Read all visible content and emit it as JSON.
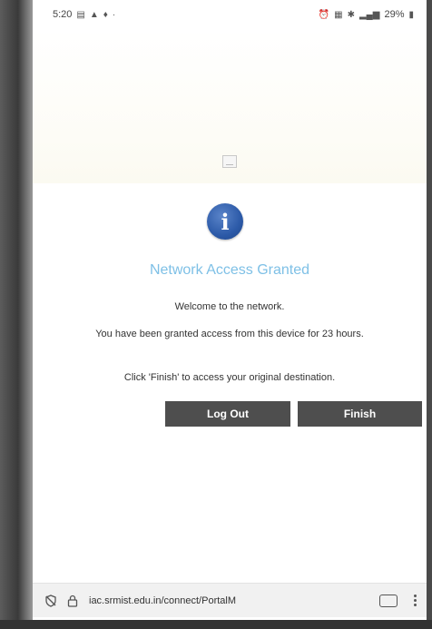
{
  "status_bar": {
    "time": "5:20",
    "right_text": "29%"
  },
  "main": {
    "title": "Network Access Granted",
    "welcome": "Welcome to the network.",
    "access_message": "You have been granted access from this device for 23 hours.",
    "finish_instruction": "Click 'Finish' to access your original destination.",
    "logout_label": "Log Out",
    "finish_label": "Finish"
  },
  "address_bar": {
    "url": "iac.srmist.edu.in/connect/PortalM"
  },
  "colors": {
    "title": "#7ec0e6",
    "button_bg": "#4e4e4e",
    "info_icon": "#2c5aa8"
  },
  "icons": [
    "shield-off-icon",
    "lock-icon",
    "tabs-icon",
    "more-menu-icon",
    "info-icon"
  ]
}
